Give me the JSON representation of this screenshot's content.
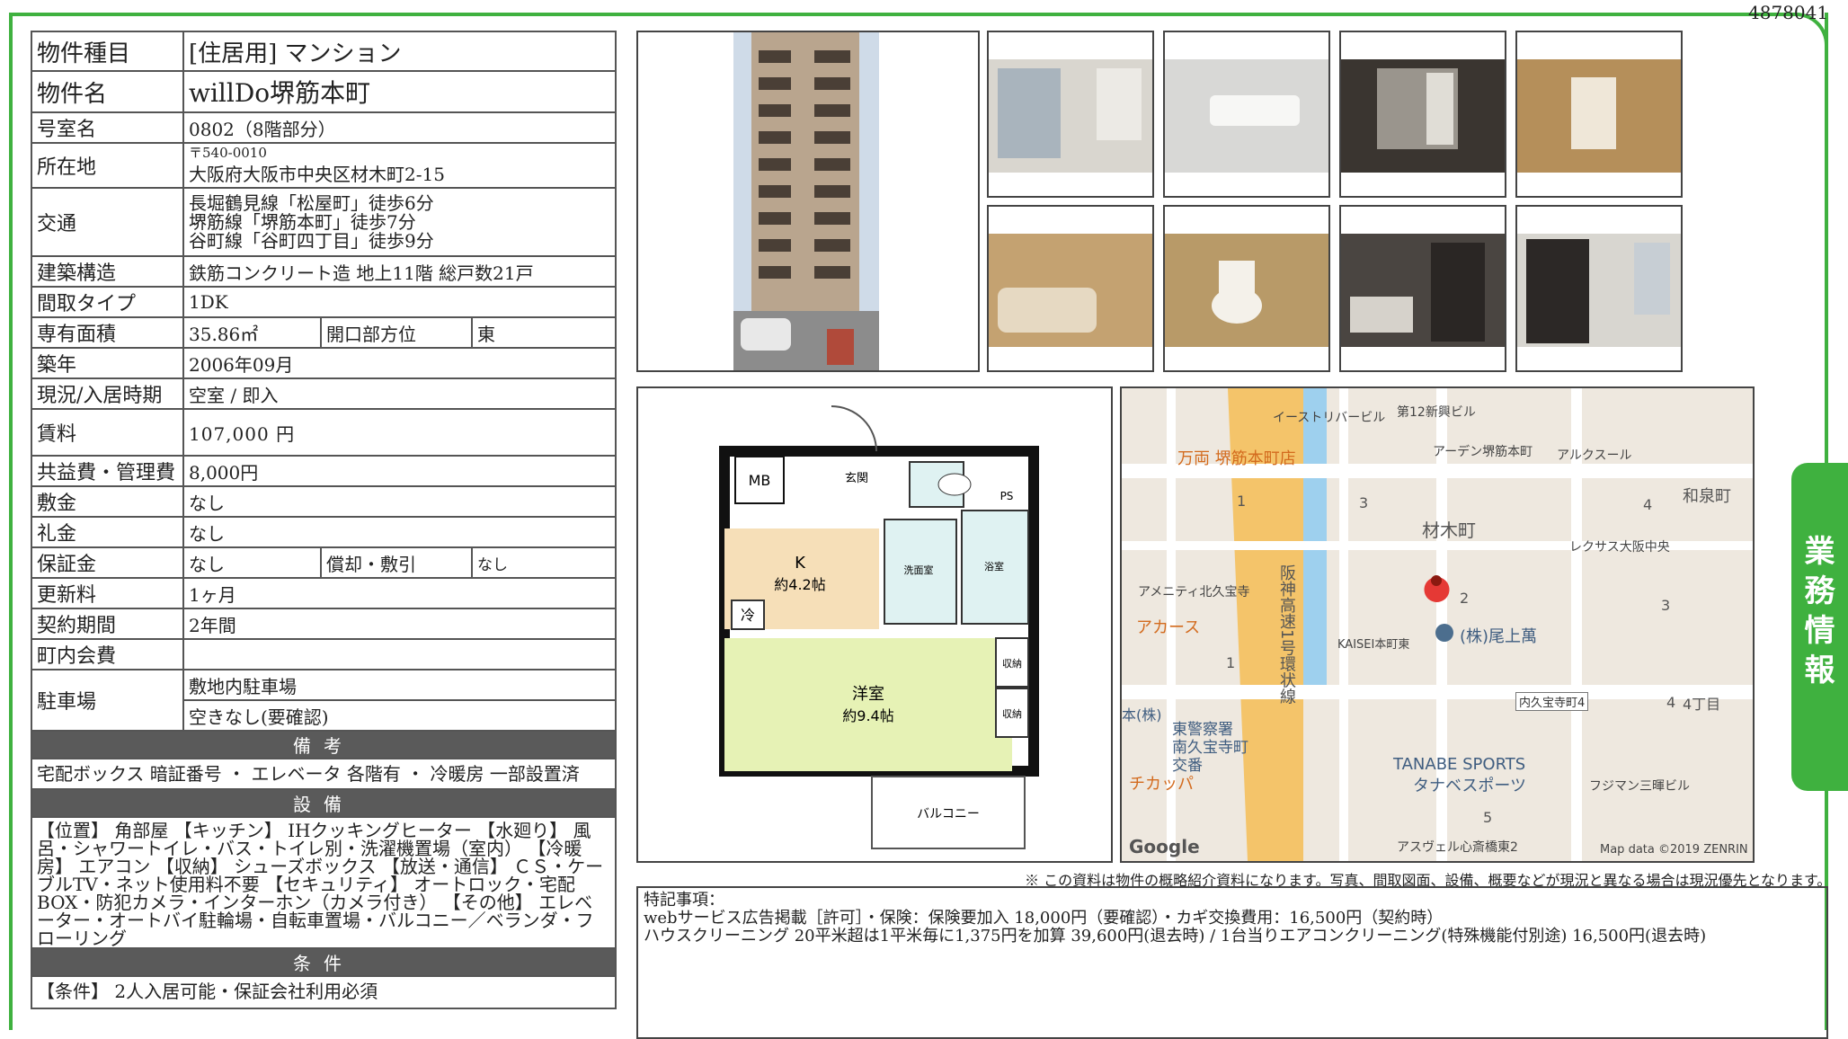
{
  "doc_id": "4878041",
  "side_tab": "業務情報",
  "property": {
    "type_label": "物件種目",
    "type_value": "[住居用] マンション",
    "name_label": "物件名",
    "name_value": "willDo堺筋本町",
    "room_label": "号室名",
    "room_value": "0802（8階部分）",
    "address_label": "所在地",
    "postal": "〒540-0010",
    "address_value": "大阪府大阪市中央区材木町2-15",
    "access_label": "交通",
    "access": [
      "長堀鶴見線「松屋町」徒歩6分",
      "堺筋線「堺筋本町」徒歩7分",
      "谷町線「谷町四丁目」徒歩9分"
    ],
    "structure_label": "建築構造",
    "structure_value": "鉄筋コンクリート造 地上11階 総戸数21戸",
    "layout_label": "間取タイプ",
    "layout_value": "1DK",
    "area_label": "専有面積",
    "area_value": "35.86㎡",
    "direction_label": "開口部方位",
    "direction_value": "東",
    "built_label": "築年",
    "built_value": "2006年09月",
    "status_label": "現況/入居時期",
    "status_value": "空室 / 即入",
    "rent_label": "賃料",
    "rent_value": "107,000 円",
    "fee_label": "共益費・管理費",
    "fee_value": "8,000円",
    "deposit_label": "敷金",
    "deposit_value": "なし",
    "keymoney_label": "礼金",
    "keymoney_value": "なし",
    "guarantee_label": "保証金",
    "guarantee_value": "なし",
    "amort_label": "償却・敷引",
    "amort_value": "なし",
    "renewal_label": "更新料",
    "renewal_value": "1ヶ月",
    "term_label": "契約期間",
    "term_value": "2年間",
    "community_label": "町内会費",
    "community_value": "",
    "parking_label": "駐車場",
    "parking_value1": "敷地内駐車場",
    "parking_value2": "空きなし(要確認)"
  },
  "remarks": {
    "heading": "備考",
    "text": "宅配ボックス 暗証番号 ・ エレベータ 各階有 ・ 冷暖房 一部設置済"
  },
  "facilities": {
    "heading": "設備",
    "text": "【位置】 角部屋 【キッチン】 IHクッキングヒーター 【水廻り】 風呂・シャワートイレ・バス・トイレ別・洗濯機置場（室内） 【冷暖房】 エアコン 【収納】 シューズボックス 【放送・通信】 ＣＳ・ケーブルTV・ネット使用料不要 【セキュリティ】 オートロック・宅配BOX・防犯カメラ・インターホン（カメラ付き） 【その他】 エレベーター・オートバイ駐輪場・自転車置場・バルコニー／ベランダ・フローリング"
  },
  "conditions": {
    "heading": "条件",
    "text": "【条件】 2人入居可能・保証会社利用必須"
  },
  "floorplan": {
    "mb": "MB",
    "entrance": "玄関",
    "ps": "PS",
    "kitchen": "K",
    "kitchen_size": "約4.2帖",
    "fridge": "冷",
    "washroom": "洗面室",
    "bath": "浴室",
    "western": "洋室",
    "western_size": "約9.4帖",
    "storage1": "収納",
    "storage2": "収納",
    "balcony": "バルコニー"
  },
  "map": {
    "labels": [
      "イーストリバービル",
      "第12新興ビル",
      "万両 堺筋本町店",
      "アーデン堺筋本町",
      "アルクスール",
      "和泉町",
      "材木町",
      "レクサス大阪中央",
      "阪神高速1号環状線",
      "アメニティ北久宝寺",
      "アカース",
      "(株)尾上萬",
      "KAISEI本町東",
      "内久宝寺町4",
      "4丁目",
      "本(株)",
      "東警察署 南久宝寺町交番",
      "TANABE SPORTS",
      "タナベスポーツ",
      "チカッパ",
      "フジマン三暉ビル",
      "アスヴェル心斎橋東2",
      "Google",
      "Map data ©2019 ZENRIN"
    ],
    "numbers": [
      "1",
      "3",
      "4",
      "2",
      "3",
      "1",
      "5",
      "4"
    ]
  },
  "disclaimer": "※ この資料は物件の概略紹介資料になります。写真、間取図面、設備、概要などが現況と異なる場合は現況優先となります。",
  "notes": {
    "title": "特記事項：",
    "line1": "webサービス広告掲載［許可］・保険：保険要加入 18,000円（要確認）・カギ交換費用：16,500円（契約時）",
    "line2": "ハウスクリーニング 20平米超は1平米毎に1,375円を加算 39,600円(退去時) / 1台当りエアコンクリーニング(特殊機能付別途) 16,500円(退去時)"
  }
}
